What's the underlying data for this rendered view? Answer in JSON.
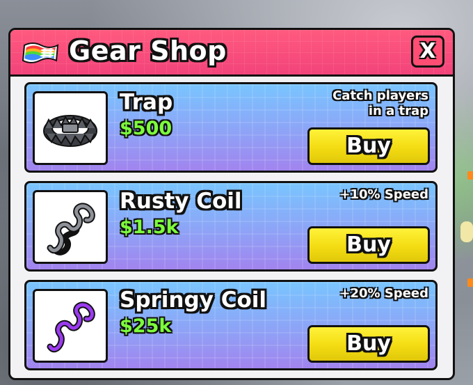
{
  "shop": {
    "title": "Gear Shop",
    "close_label": "X",
    "title_icon": "rainbow-carpet-icon"
  },
  "items": [
    {
      "name": "Trap",
      "price": "$500",
      "desc_line1": "Catch players",
      "desc_line2": "in a trap",
      "buy_label": "Buy",
      "icon": "bear-trap-icon"
    },
    {
      "name": "Rusty Coil",
      "price": "$1.5k",
      "desc_line1": "+10% Speed",
      "desc_line2": "",
      "buy_label": "Buy",
      "icon": "gray-coil-icon"
    },
    {
      "name": "Springy Coil",
      "price": "$25k",
      "desc_line1": "+20% Speed",
      "desc_line2": "",
      "buy_label": "Buy",
      "icon": "purple-coil-icon"
    }
  ],
  "colors": {
    "title_bar": "#f2437a",
    "card_top": "#79c5ff",
    "card_bottom": "#a184ee",
    "price": "#7dff3c",
    "buy_button": "#f3dc12"
  }
}
